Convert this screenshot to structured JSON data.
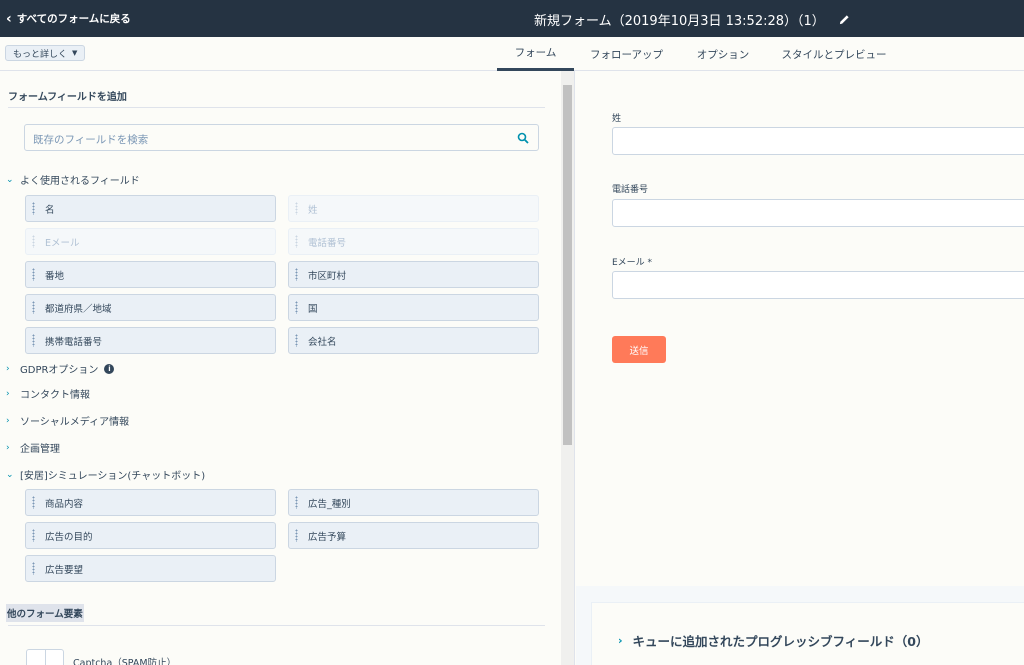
{
  "header": {
    "back_label": "すべてのフォームに戻る",
    "title": "新規フォーム（2019年10月3日 13:52:28）（1）"
  },
  "toolbar": {
    "more_label": "もっと詳しく"
  },
  "tabs": [
    {
      "label": "フォーム",
      "active": true
    },
    {
      "label": "フォローアップ",
      "active": false
    },
    {
      "label": "オプション",
      "active": false
    },
    {
      "label": "スタイルとプレビュー",
      "active": false
    }
  ],
  "left": {
    "title": "フォームフィールドを追加",
    "search_placeholder": "既存のフィールドを検索",
    "sections": [
      {
        "label": "よく使用されるフィールド",
        "expanded": true
      },
      {
        "label": "GDPRオプション",
        "expanded": false
      },
      {
        "label": "コンタクト情報",
        "expanded": false
      },
      {
        "label": "ソーシャルメディア情報",
        "expanded": false
      },
      {
        "label": "企画管理",
        "expanded": false
      },
      {
        "label": "[安居]シミュレーション(チャットボット)",
        "expanded": true
      }
    ],
    "common_fields": [
      "名",
      "姓",
      "Eメール",
      "電話番号",
      "番地",
      "市区町村",
      "都道府県／地域",
      "国",
      "携帯電話番号",
      "会社名"
    ],
    "common_fields_disabled": [
      false,
      true,
      true,
      true,
      false,
      false,
      false,
      false,
      false,
      false
    ],
    "sim_fields": [
      "商品内容",
      "広告_種別",
      "広告の目的",
      "広告予算",
      "広告要望"
    ],
    "other_title": "他のフォーム要素",
    "captcha_label": "Captcha（SPAM防止）"
  },
  "preview": {
    "fields": [
      {
        "label": "姓"
      },
      {
        "label": "電話番号"
      },
      {
        "label": "Eメール *"
      }
    ],
    "submit_label": "送信",
    "queue_label": "キューに追加されたプログレッシブフィールド（0）"
  },
  "colors": {
    "topbar": "#253342",
    "submit": "#ff7a59",
    "accent": "#0091ae"
  }
}
